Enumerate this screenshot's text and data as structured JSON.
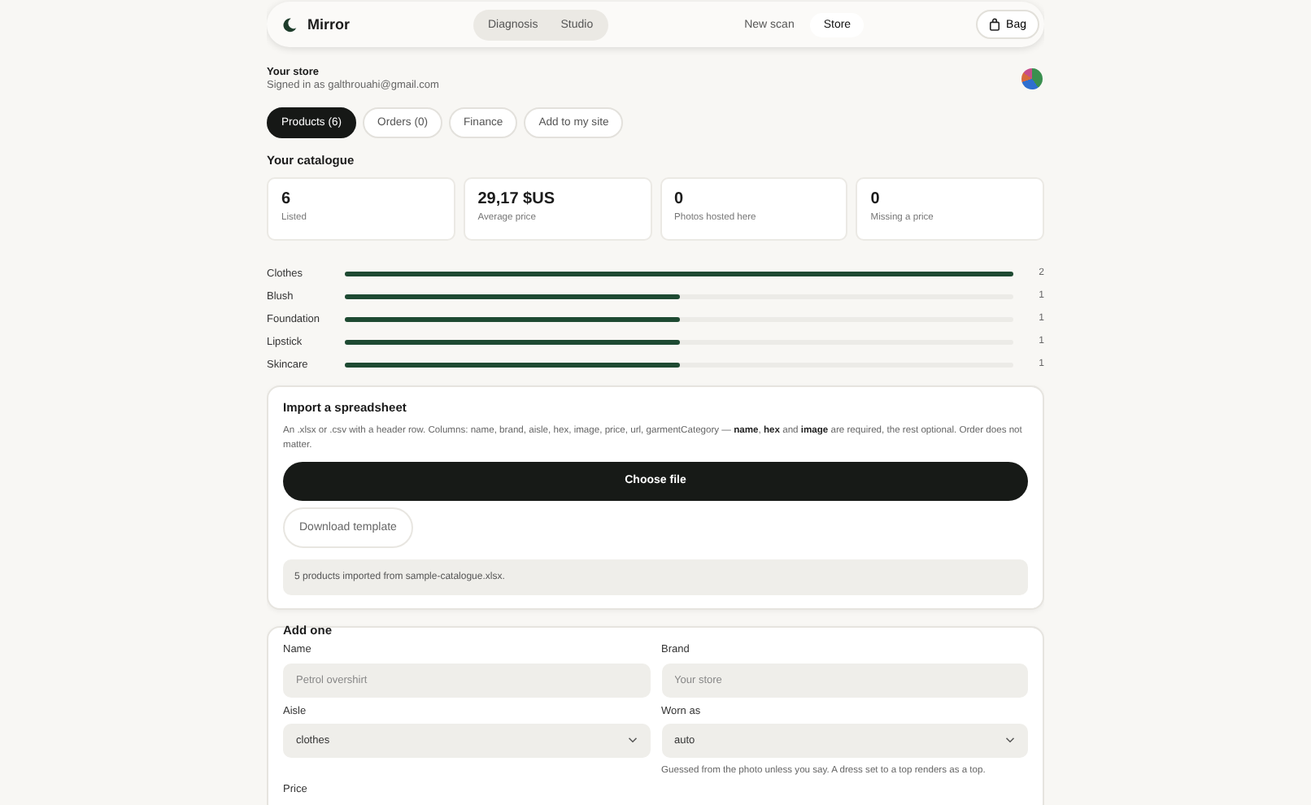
{
  "nav": {
    "brand": "Mirror",
    "modes": [
      {
        "label": "Diagnosis",
        "selected": false
      },
      {
        "label": "Studio",
        "selected": false
      }
    ],
    "links": [
      {
        "label": "New scan",
        "selected": false
      },
      {
        "label": "Store",
        "selected": true
      }
    ],
    "bag": "Bag"
  },
  "store": {
    "title": "Your store",
    "subtitle": "Signed in as galthrouahi@gmail.com"
  },
  "tabs": [
    {
      "label": "Products (6)",
      "selected": true
    },
    {
      "label": "Orders (0)",
      "selected": false
    },
    {
      "label": "Finance",
      "selected": false
    },
    {
      "label": "Add to my site",
      "selected": false
    }
  ],
  "catalogue": {
    "title": "Your catalogue",
    "stats": [
      {
        "value": "6",
        "label": "Listed"
      },
      {
        "value": "29,17 $US",
        "label": "Average price"
      },
      {
        "value": "0",
        "label": "Photos hosted here"
      },
      {
        "value": "0",
        "label": "Missing a price"
      }
    ],
    "aisles": [
      {
        "name": "Clothes",
        "level": 1,
        "count": "2"
      },
      {
        "name": "Blush",
        "level": 0.5,
        "count": "1"
      },
      {
        "name": "Foundation",
        "level": 0.5,
        "count": "1"
      },
      {
        "name": "Lipstick",
        "level": 0.5,
        "count": "1"
      },
      {
        "name": "Skincare",
        "level": 0.5,
        "count": "1"
      }
    ]
  },
  "import": {
    "title": "Import a spreadsheet",
    "description": "An .xlsx or .csv with a header row. Columns: name, brand, aisle, hex, image, price, url, garmentCategory — **name**, **hex** and **image** are required, the rest optional. Order does not matter.",
    "choose": "Choose file",
    "template": "Download template",
    "status": "5 products imported from sample-catalogue.xlsx."
  },
  "add": {
    "title": "Add one",
    "fields": [
      {
        "label": "Name",
        "kind": "text",
        "placeholder": "Petrol overshirt"
      },
      {
        "label": "Brand",
        "kind": "text",
        "placeholder": "Your store"
      },
      {
        "label": "Aisle",
        "kind": "select",
        "value": "clothes"
      },
      {
        "label": "Worn as",
        "kind": "select",
        "value": "auto",
        "hint": "Guessed from the photo unless you say. A dress set to a top renders as a top."
      },
      {
        "label": "Price",
        "kind": "label"
      }
    ]
  }
}
